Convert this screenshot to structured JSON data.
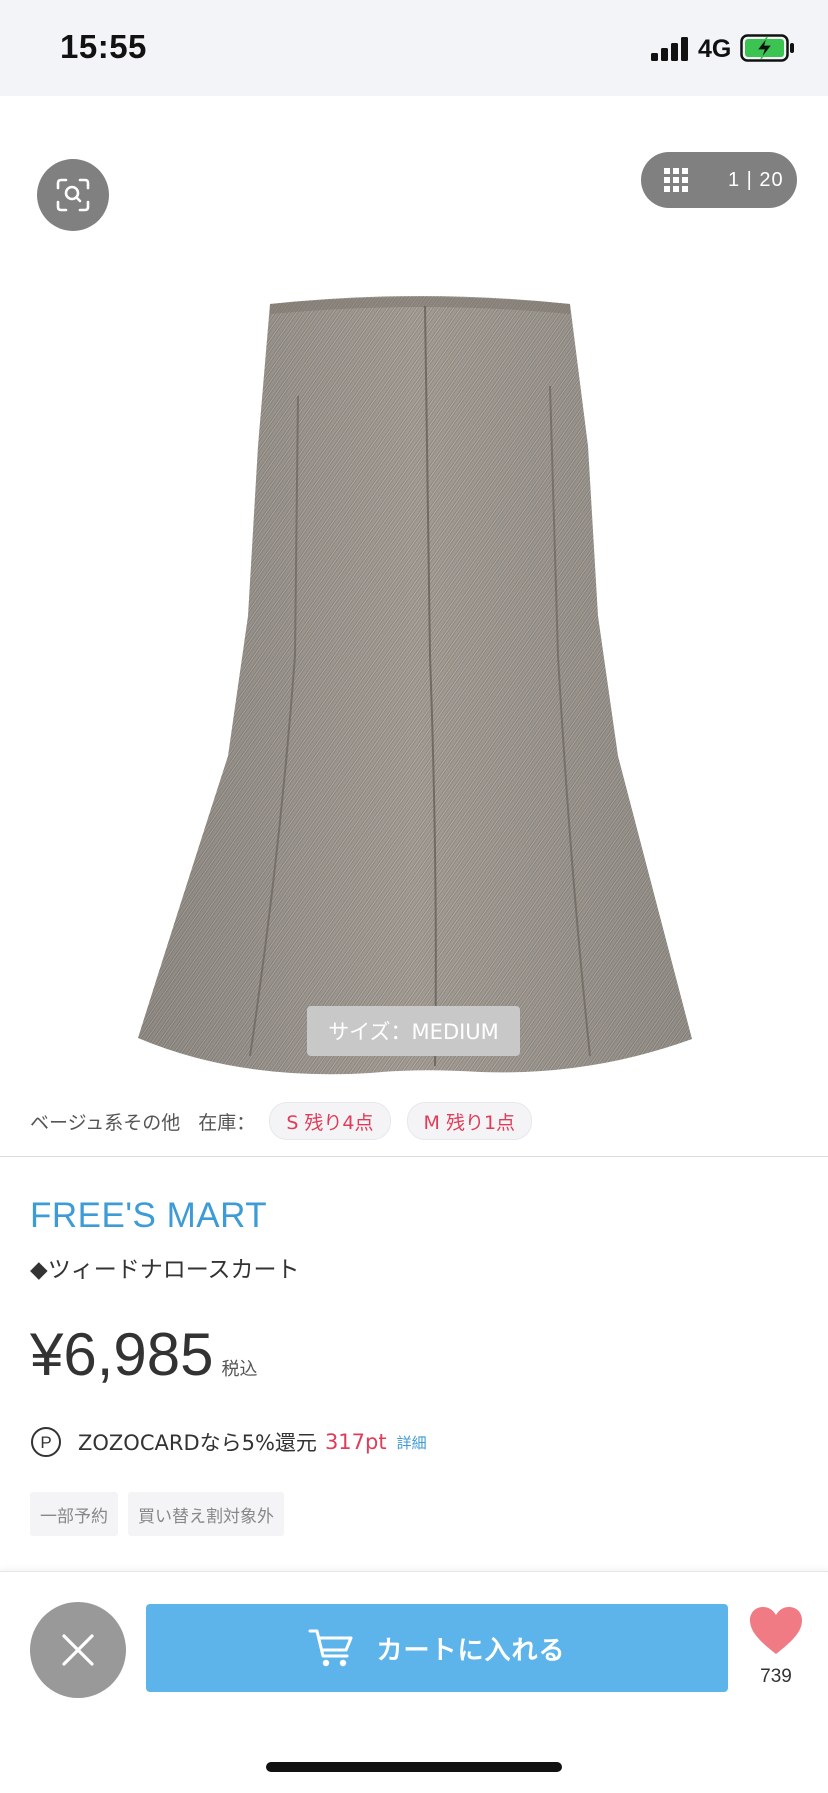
{
  "status_bar": {
    "time": "15:55",
    "network": "4G",
    "signal_icon": "signal-bars-icon",
    "battery_icon": "battery-charging-icon"
  },
  "gallery": {
    "visual_search_icon": "visual-search-icon",
    "grid_icon": "grid-icon",
    "counter": "1 | 20",
    "size_badge": "サイズ：MEDIUM"
  },
  "stock": {
    "color": "ベージュ系その他",
    "label": "在庫：",
    "chips": [
      {
        "label": "S 残り4点"
      },
      {
        "label": "M 残り1点"
      }
    ]
  },
  "product": {
    "brand": "FREE'S MART",
    "name": "◆ツィードナロースカート",
    "price": "¥6,985",
    "tax_label": "税込",
    "points_icon": "points-p-icon",
    "zozocard_text": "ZOZOCARDなら5%還元",
    "points_value": "317pt",
    "details_link": "詳細",
    "tags": [
      "一部予約",
      "買い替え割対象外"
    ]
  },
  "bottom_bar": {
    "close_icon": "close-x-icon",
    "cart_icon": "cart-icon",
    "cart_label": "カートに入れる",
    "favorite_icon": "heart-icon",
    "favorite_count": "739"
  },
  "colors": {
    "brand_blue": "#3d9bd6",
    "cart_button": "#5db4eb",
    "stock_red": "#e03c5a",
    "heart_pink": "#f07b85",
    "overlay_gray": "#808080"
  }
}
